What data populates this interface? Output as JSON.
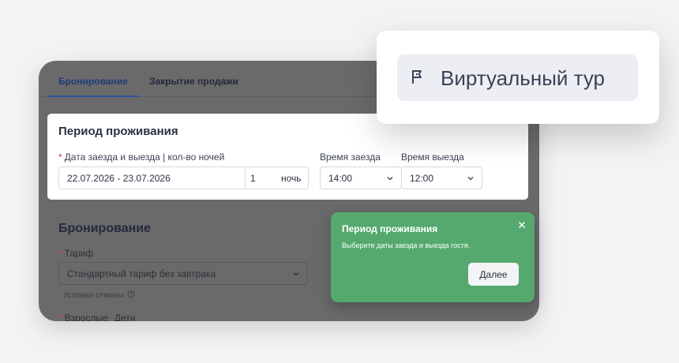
{
  "tabs": {
    "booking": "Бронирование",
    "close_sale": "Закрытие продажи"
  },
  "stay": {
    "title": "Период проживания",
    "dates_label": "Дата заезда и выезда | кол-во ночей",
    "dates_value": "22.07.2026 - 23.07.2026",
    "nights_value": "1",
    "nights_unit": "ночь",
    "checkin_label": "Время заезда",
    "checkin_value": "14:00",
    "checkout_label": "Время выезда",
    "checkout_value": "12:00"
  },
  "booking": {
    "title": "Бронирование",
    "tariff_label": "Тариф",
    "tariff_value": "Стандартный тариф без завтрака",
    "cancel_conditions": "Условия отмены",
    "adults_label": "Взрослые",
    "children_label": "Дети"
  },
  "tooltip": {
    "title": "Период проживания",
    "text": "Выберите даты заезда и выезда гостя.",
    "next_label": "Далее"
  },
  "virtual_tour": {
    "label": "Виртуальный тур",
    "icon": "flag-icon"
  },
  "colors": {
    "tooltip_bg": "#55a96f",
    "accent": "#2c54a6",
    "required": "#d83a3a"
  }
}
